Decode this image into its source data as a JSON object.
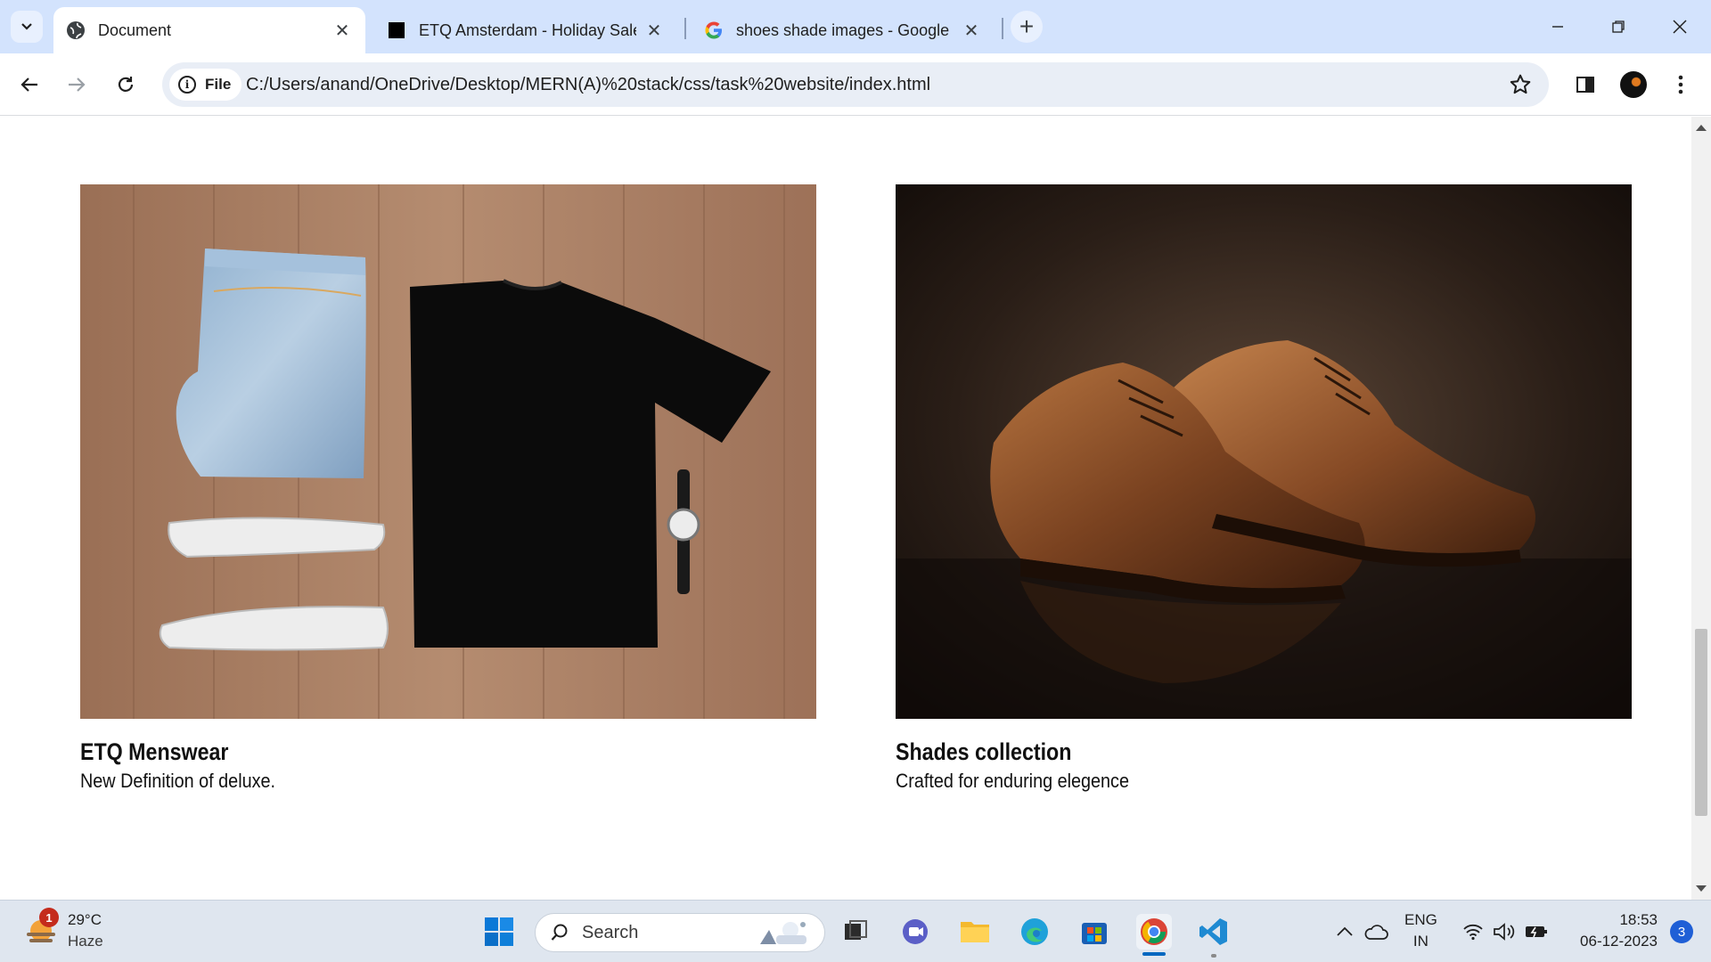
{
  "browser": {
    "tabs": [
      {
        "title": "Document",
        "favicon": "globe-icon",
        "active": true
      },
      {
        "title": "ETQ Amsterdam - Holiday Sale",
        "favicon": "etq-square-icon",
        "active": false
      },
      {
        "title": "shoes shade images - Google S",
        "favicon": "google-g-icon",
        "active": false
      }
    ],
    "site_chip_label": "File",
    "url": "C:/Users/anand/OneDrive/Desktop/MERN(A)%20stack/css/task%20website/index.html"
  },
  "page": {
    "cards": [
      {
        "title": "ETQ Menswear",
        "subtitle": "New Definition of deluxe.",
        "image": "flat-lay-jeans-tshirt-sneakers-watch"
      },
      {
        "title": "Shades collection",
        "subtitle": "Crafted for enduring elegence",
        "image": "brown-leather-brogue-shoes"
      }
    ]
  },
  "taskbar": {
    "weather": {
      "temp": "29°C",
      "condition": "Haze",
      "badge": "1"
    },
    "search_label": "Search",
    "tray": {
      "lang_top": "ENG",
      "lang_bottom": "IN"
    },
    "clock": {
      "time": "18:53",
      "date": "06-12-2023"
    },
    "notifications": "3"
  },
  "colors": {
    "tabstrip": "#d3e3fd",
    "omnibox": "#e9eef6",
    "taskbar": "#dfe6ef",
    "accent": "#0067c0"
  }
}
